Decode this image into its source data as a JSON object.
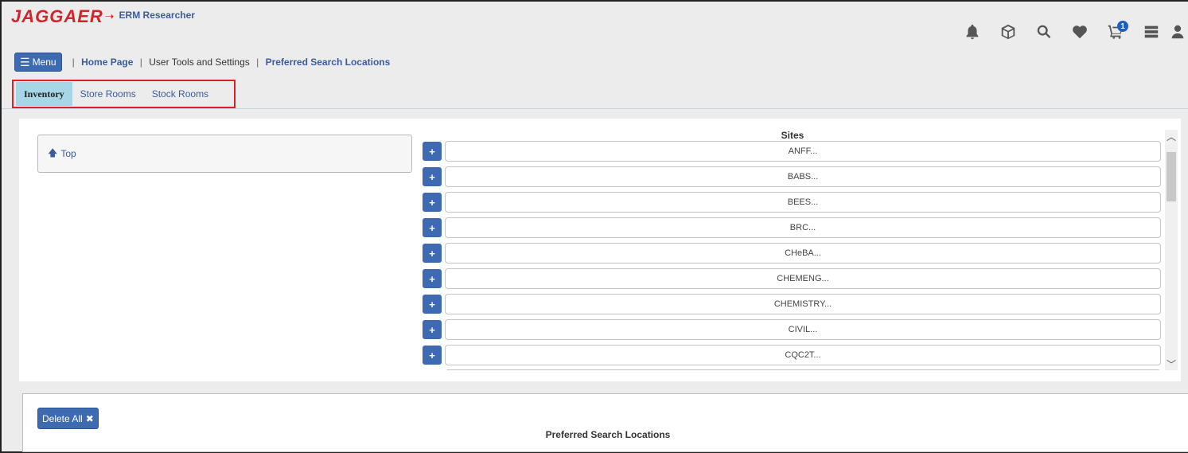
{
  "header": {
    "logo_text": "JAGGAER",
    "app_name": "ERM Researcher",
    "icons": [
      "bell-icon",
      "cube-icon",
      "search-icon",
      "heart-icon",
      "cart-icon",
      "server-icon",
      "user-icon"
    ],
    "cart_count": "1"
  },
  "nav": {
    "menu_label": "Menu",
    "breadcrumb": {
      "home": "Home Page",
      "tools": "User Tools and Settings",
      "current": "Preferred Search Locations"
    }
  },
  "tabs": [
    {
      "label": "Inventory",
      "active": true
    },
    {
      "label": "Store Rooms",
      "active": false
    },
    {
      "label": "Stock Rooms",
      "active": false
    }
  ],
  "tree": {
    "top_label": "Top"
  },
  "sites": {
    "title": "Sites",
    "items": [
      "ANFF...",
      "BABS...",
      "BEES...",
      "BRC...",
      "CHeBA...",
      "CHEMENG...",
      "CHEMISTRY...",
      "CIVIL...",
      "CQC2T..."
    ]
  },
  "preferred": {
    "delete_label": "Delete All",
    "title": "Preferred Search Locations"
  },
  "colors": {
    "brand_red": "#d2252b",
    "button_blue": "#3d6ab0",
    "active_tab": "#a7d6e6",
    "highlight_border": "#e01e26"
  }
}
